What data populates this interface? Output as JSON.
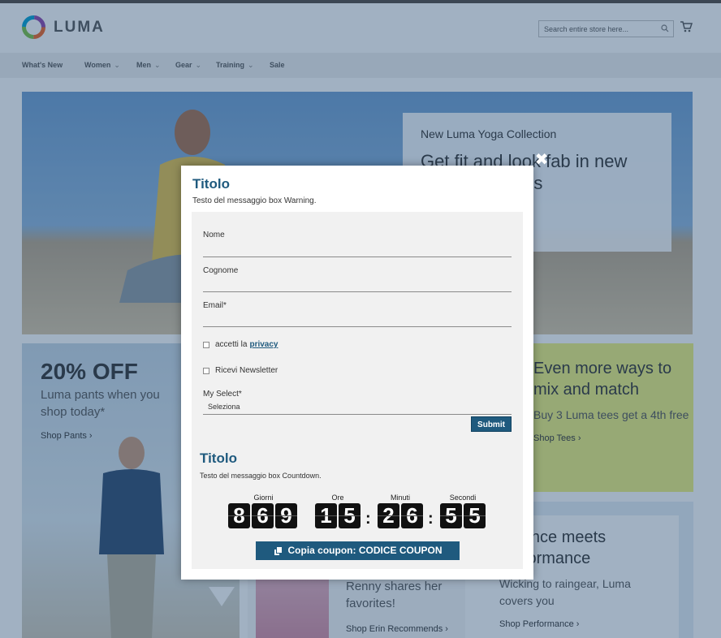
{
  "header": {
    "logo_text": "LUMA",
    "search_placeholder": "Search entire store here...",
    "nav": [
      "What's New",
      "Women",
      "Men",
      "Gear",
      "Training",
      "Sale"
    ]
  },
  "hero": {
    "kicker": "New Luma Yoga Collection",
    "headline": "Get fit and look fab in new seasonal styles"
  },
  "promo_pants": {
    "title": "20% OFF",
    "subtitle": "Luma pants when you shop today*",
    "link": "Shop Pants"
  },
  "promo_tees": {
    "title": "Even more ways to mix and match",
    "subtitle": "Buy 3 Luma tees get a 4th free",
    "link": "Shop Tees"
  },
  "promo_erin": {
    "text": "Renny shares her favorites!",
    "link": "Shop Erin Recommends"
  },
  "promo_perf": {
    "title": "Science meets performance",
    "subtitle": "Wicking to raingear, Luma covers you",
    "link": "Shop Performance"
  },
  "modal": {
    "close": "✖",
    "warning_title": "Titolo",
    "warning_text": "Testo del messaggio box Warning.",
    "form": {
      "nome_label": "Nome",
      "cognome_label": "Cognome",
      "email_label": "Email*",
      "privacy_text": "accetti la",
      "privacy_link": "privacy",
      "newsletter_text": "Ricevi Newsletter",
      "select_label": "My Select*",
      "select_value": "Seleziona",
      "submit": "Submit"
    },
    "countdown_title": "Titolo",
    "countdown_text": "Testo del messaggio box Countdown.",
    "countdown": {
      "giorni_label": "Giorni",
      "giorni": [
        "8",
        "6",
        "9"
      ],
      "ore_label": "Ore",
      "ore": [
        "1",
        "5"
      ],
      "minuti_label": "Minuti",
      "minuti": [
        "2",
        "6"
      ],
      "secondi_label": "Secondi",
      "secondi": [
        "5",
        "5"
      ]
    },
    "coupon_button": "Copia coupon: CODICE COUPON"
  },
  "colors": {
    "brand_blue": "#1f5a7e",
    "overlay": "#1e466e",
    "promo_green": "#eef17a"
  }
}
